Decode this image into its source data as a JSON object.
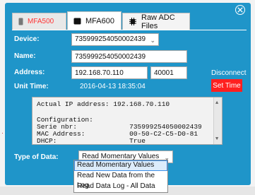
{
  "colors": {
    "panel": "#1f95c9",
    "danger": "#ff2020"
  },
  "tabs": [
    {
      "label": "MFA500",
      "icon": "device-icon"
    },
    {
      "label": "MFA600",
      "icon": "device-icon"
    },
    {
      "label": "Raw ADC Files",
      "icon": "circuit-icon"
    }
  ],
  "form": {
    "device_label": "Device:",
    "device_value": "735999254050002439",
    "name_label": "Name:",
    "name_value": "735999254050002439",
    "address_label": "Address:",
    "address_ip": "192.168.70.110",
    "address_port": "40001",
    "disconnect_label": "Disconnect",
    "unit_time_label": "Unit Time:",
    "unit_time_value": "2016-04-13 18:35:04",
    "set_time_label": "Set Time"
  },
  "console": {
    "lines": [
      "Actual IP address: 192.168.70.110",
      "",
      "Configuration:",
      "Serie nbr:             735999254050002439",
      "MAC Address:           00-50-C2-C5-D0-81",
      "DHCP:                  True"
    ]
  },
  "data_type": {
    "label": "Type of Data:",
    "selected": "Read Momentary Values",
    "options": [
      "Read Momentary Values",
      "Read New Data from the Log",
      "Read Data Log - All Data"
    ]
  }
}
